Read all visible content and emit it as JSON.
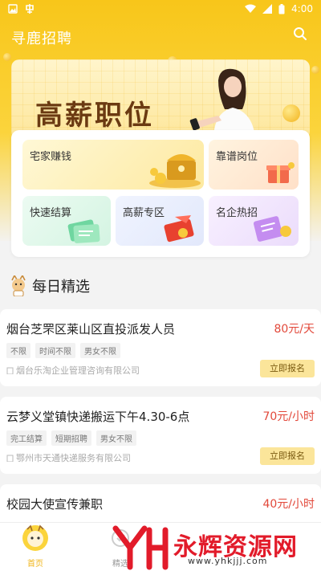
{
  "status_bar": {
    "time": "4:00"
  },
  "app": {
    "title": "寻鹿招聘"
  },
  "banner": {
    "title": "高薪职位"
  },
  "categories": [
    {
      "label": "宅家赚钱"
    },
    {
      "label": "靠谱岗位"
    },
    {
      "label": "快速结算"
    },
    {
      "label": "高薪专区"
    },
    {
      "label": "名企热招"
    }
  ],
  "section": {
    "title": "每日精选"
  },
  "jobs": [
    {
      "title": "烟台芝罘区莱山区直投派发人员",
      "salary": "80元/天",
      "tags": [
        "不限",
        "时间不限",
        "男女不限"
      ],
      "company": "烟台乐淘企业管理咨询有限公司",
      "apply": "立即报名"
    },
    {
      "title": "云梦义堂镇快递搬运下午4.30-6点",
      "salary": "70元/小时",
      "tags": [
        "完工结算",
        "短期招聘",
        "男女不限"
      ],
      "company": "鄂州市天通快递服务有限公司",
      "apply": "立即报名"
    },
    {
      "title": "校园大使宣传兼职",
      "salary": "40元/小时",
      "tags": [],
      "company": "",
      "apply": ""
    }
  ],
  "bottom_nav": [
    {
      "label": "首页",
      "active": true
    },
    {
      "label": "精选",
      "active": false
    }
  ],
  "watermark": {
    "text": "永辉资源网",
    "url": "www.yhkjjj.com"
  },
  "colors": {
    "brand": "#f8c61a",
    "salary": "#e2483a",
    "apply_bg": "#fbe59a"
  }
}
